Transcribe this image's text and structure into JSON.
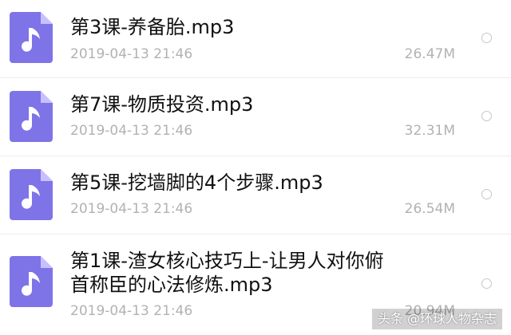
{
  "colors": {
    "icon": "#7F73E8",
    "icon_fold": "#C7C0FF",
    "filename": "#111111",
    "meta": "#B2B2B2",
    "radio": "#C7C7C7",
    "divider": "#ECECEC"
  },
  "files": [
    {
      "icon": "music-note-icon",
      "name": "第3课-养备胎.mp3",
      "date": "2019-04-13 21:46",
      "size": "26.47M"
    },
    {
      "icon": "music-note-icon",
      "name": "第7课-物质投资.mp3",
      "date": "2019-04-13 21:46",
      "size": "32.31M"
    },
    {
      "icon": "music-note-icon",
      "name": "第5课-挖墙脚的4个步骤.mp3",
      "date": "2019-04-13 21:46",
      "size": "26.54M"
    },
    {
      "icon": "music-note-icon",
      "name": "第1课-渣女核心技巧上-让男人对你俯\n首称臣的心法修炼.mp3",
      "date": "2019-04-13 21:46",
      "size": "20.94M"
    }
  ],
  "watermark": "头条 @环球人物杂志"
}
